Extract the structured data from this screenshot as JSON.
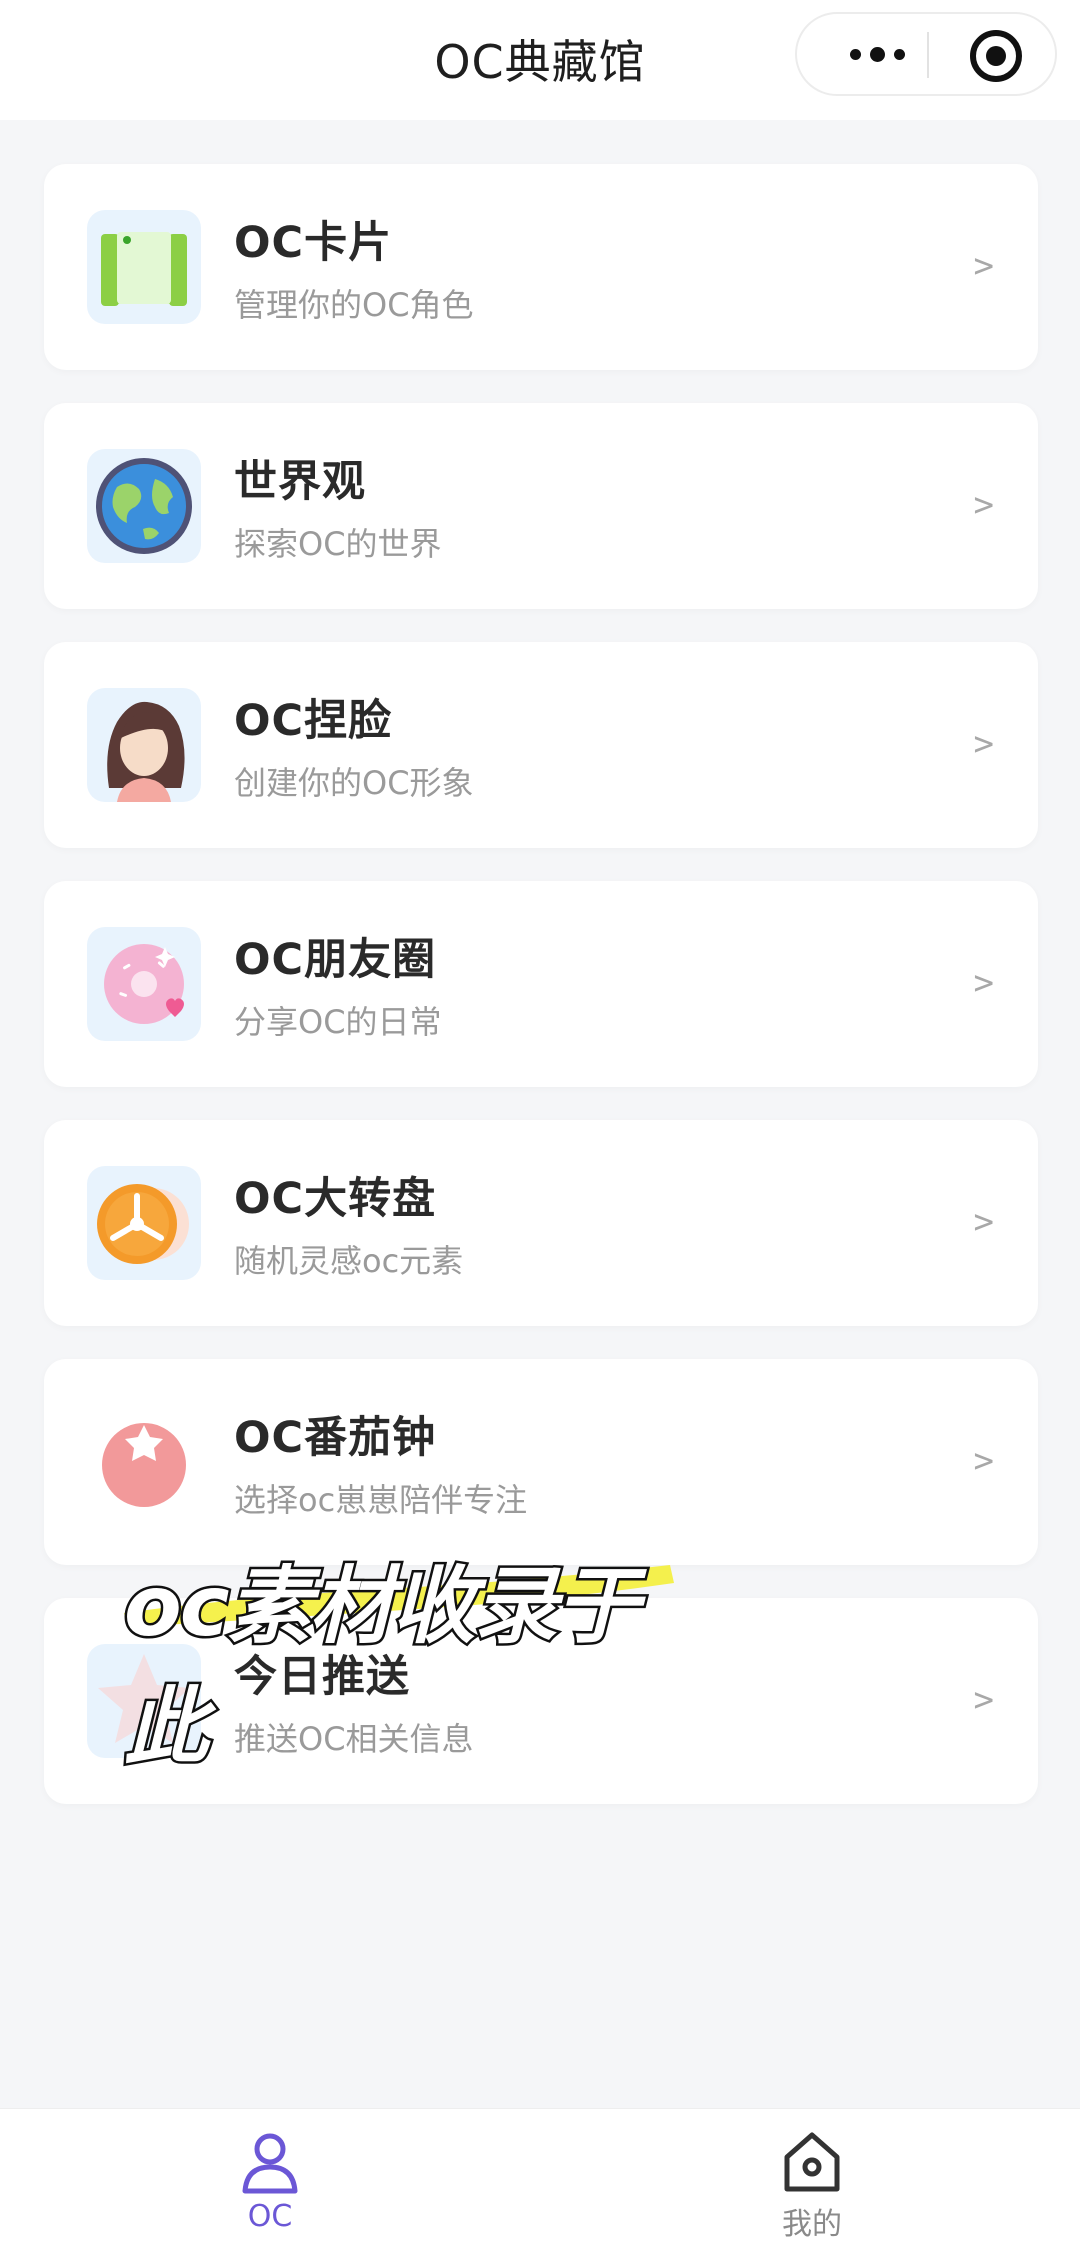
{
  "header": {
    "title": "OC典藏馆"
  },
  "menu": [
    {
      "title": "OC卡片",
      "subtitle": "管理你的OC角色",
      "icon": "book-icon",
      "chevron": ">"
    },
    {
      "title": "世界观",
      "subtitle": "探索OC的世界",
      "icon": "globe-icon",
      "chevron": ">"
    },
    {
      "title": "OC捏脸",
      "subtitle": "创建你的OC形象",
      "icon": "girl-avatar-icon",
      "chevron": ">"
    },
    {
      "title": "OC朋友圈",
      "subtitle": "分享OC的日常",
      "icon": "donut-icon",
      "chevron": ">"
    },
    {
      "title": "OC大转盘",
      "subtitle": "随机灵感oc元素",
      "icon": "wheel-icon",
      "chevron": ">"
    },
    {
      "title": "OC番茄钟",
      "subtitle": "选择oc崽崽陪伴专注",
      "icon": "tomato-icon",
      "chevron": ">"
    },
    {
      "title": "今日推送",
      "subtitle": "推送OC相关信息",
      "icon": "star-icon",
      "chevron": ">"
    }
  ],
  "overlay_caption": "oc素材收录于此",
  "tabbar": {
    "tabs": [
      {
        "label": "OC",
        "icon": "person-icon",
        "active": true
      },
      {
        "label": "我的",
        "icon": "home-icon",
        "active": false
      }
    ]
  },
  "colors": {
    "accent": "#6b57d6",
    "background": "#f5f6f8",
    "highlight": "#f4ef3a"
  }
}
